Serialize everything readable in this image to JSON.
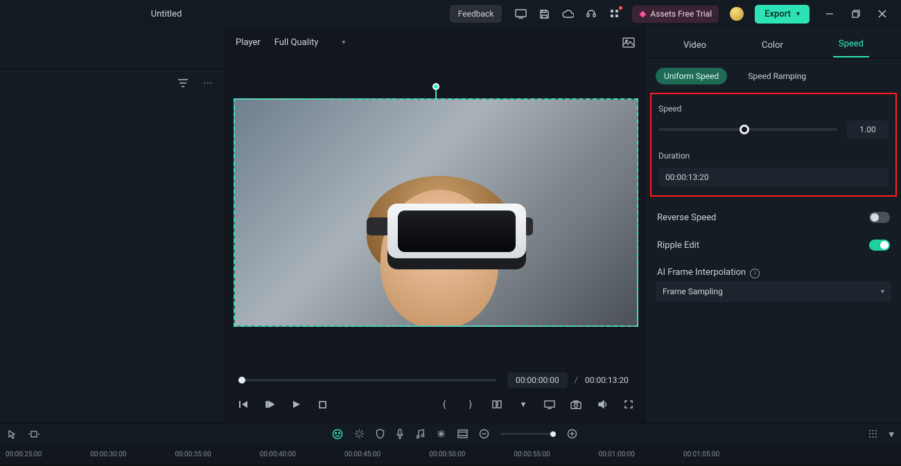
{
  "titlebar": {
    "title": "Untitled",
    "feedback": "Feedback",
    "assets_trial": "Assets Free Trial",
    "export": "Export"
  },
  "player": {
    "label": "Player",
    "quality": "Full Quality",
    "current_time": "00:00:00:00",
    "separator": "/",
    "duration": "00:00:13:20"
  },
  "right_panel": {
    "tabs": {
      "video": "Video",
      "color": "Color",
      "speed": "Speed"
    },
    "subtabs": {
      "uniform": "Uniform Speed",
      "ramping": "Speed Ramping"
    },
    "speed_label": "Speed",
    "speed_value": "1.00",
    "duration_label": "Duration",
    "duration_value": "00:00:13:20",
    "reverse_label": "Reverse Speed",
    "ripple_label": "Ripple Edit",
    "ai_label": "AI Frame Interpolation",
    "ai_value": "Frame Sampling"
  },
  "timeline": {
    "ticks": [
      "00:00:25:00",
      "00:00:30:00",
      "00:00:35:00",
      "00:00:40:00",
      "00:00:45:00",
      "00:00:50:00",
      "00:00:55:00",
      "00:01:00:00",
      "00:01:05:00"
    ]
  }
}
